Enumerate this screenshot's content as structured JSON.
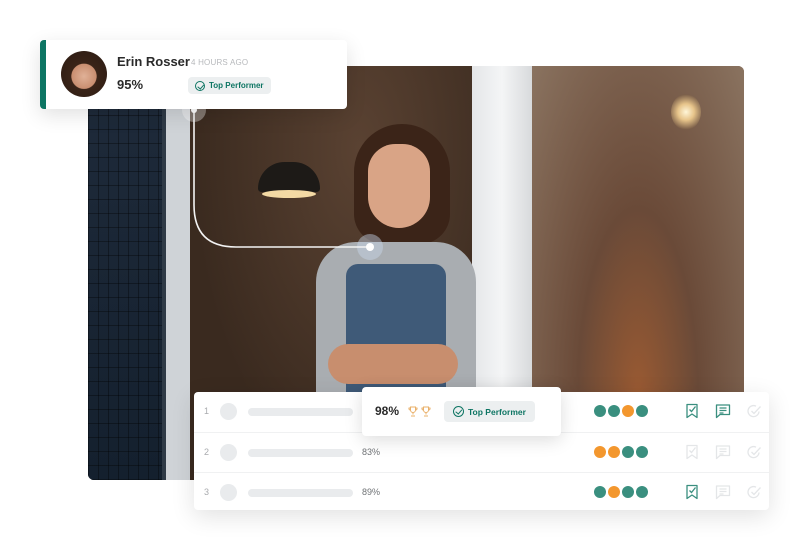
{
  "profile_card": {
    "name": "Erin Rosser",
    "time_ago": "4 HOURS AGO",
    "score": "95%",
    "badge_label": "Top Performer",
    "accent_color": "#0d7563"
  },
  "highlight": {
    "score": "98%",
    "trophy_count": 2,
    "badge_label": "Top Performer"
  },
  "colors": {
    "teal": "#3a8f7f",
    "orange": "#f3972e",
    "icon_active": "#3a8f7f",
    "icon_inactive": "#e4e6e8"
  },
  "leaderboard": {
    "rows": [
      {
        "rank": "1",
        "score": "98%",
        "dots": [
          "teal",
          "teal",
          "orange",
          "teal"
        ],
        "bookmark_active": true,
        "comment_active": true,
        "approve_active": false
      },
      {
        "rank": "2",
        "score": "83%",
        "dots": [
          "orange",
          "orange",
          "teal",
          "teal"
        ],
        "bookmark_active": false,
        "comment_active": false,
        "approve_active": false
      },
      {
        "rank": "3",
        "score": "89%",
        "dots": [
          "teal",
          "orange",
          "teal",
          "teal"
        ],
        "bookmark_active": true,
        "comment_active": false,
        "approve_active": false
      }
    ]
  }
}
